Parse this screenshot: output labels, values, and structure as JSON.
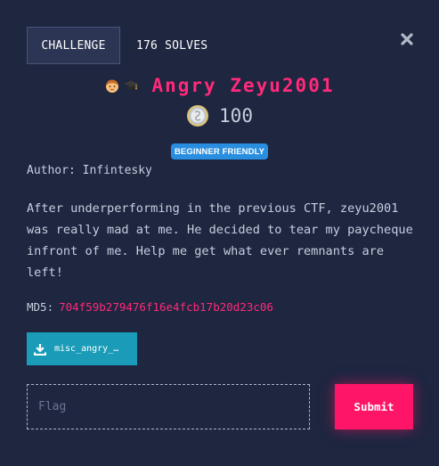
{
  "header": {
    "tab_label": "CHALLENGE",
    "solves_text": "176 SOLVES"
  },
  "challenge": {
    "title": "Angry Zeyu2001",
    "title_emojis": [
      "boy-icon",
      "graduation-cap-icon"
    ],
    "points": "100",
    "badge": "BEGINNER FRIENDLY",
    "author": "Author: Infintesky",
    "description": "After underperforming in the previous CTF, zeyu2001 was really mad at me. He decided to tear my paycheque infront of me. Help me get what ever remnants are left!",
    "md5_label": "MD5:",
    "md5_value": "704f59b279476f16e4fcb17b20d23c06",
    "file_label": "misc_angry_…"
  },
  "form": {
    "flag_placeholder": "Flag",
    "submit_label": "Submit"
  },
  "colors": {
    "background": "#1e2640",
    "accent_pink": "#ff1567",
    "badge_blue": "#2a8ee0",
    "download_teal": "#1a9cb8"
  }
}
